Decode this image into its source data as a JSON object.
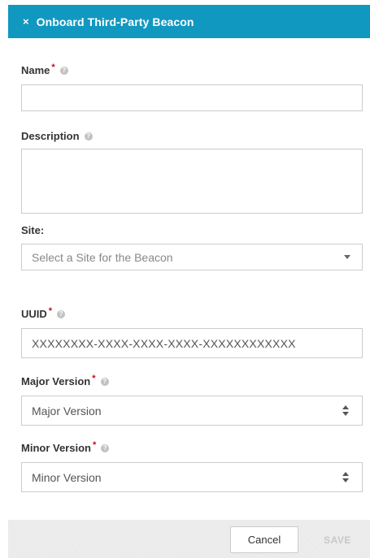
{
  "header": {
    "close_glyph": "×",
    "title": "Onboard Third-Party Beacon",
    "color": "#1198c0"
  },
  "form": {
    "name": {
      "label": "Name",
      "required_mark": "*",
      "help_glyph": "?",
      "value": ""
    },
    "description": {
      "label": "Description",
      "help_glyph": "?",
      "value": ""
    },
    "site": {
      "label": "Site:",
      "placeholder": "Select a Site for the Beacon"
    },
    "uuid": {
      "label": "UUID",
      "required_mark": "*",
      "help_glyph": "?",
      "value": "XXXXXXXX-XXXX-XXXX-XXXX-XXXXXXXXXXXX"
    },
    "major_version": {
      "label": "Major Version",
      "required_mark": "*",
      "help_glyph": "?",
      "placeholder": "Major Version"
    },
    "minor_version": {
      "label": "Minor Version",
      "required_mark": "*",
      "help_glyph": "?",
      "placeholder": "Minor Version"
    }
  },
  "footer": {
    "cancel_label": "Cancel",
    "save_label": "SAVE"
  },
  "icons": {
    "close": "close-icon",
    "help": "help-icon",
    "dropdown": "chevron-down-icon",
    "spinner": "stepper-icon"
  }
}
